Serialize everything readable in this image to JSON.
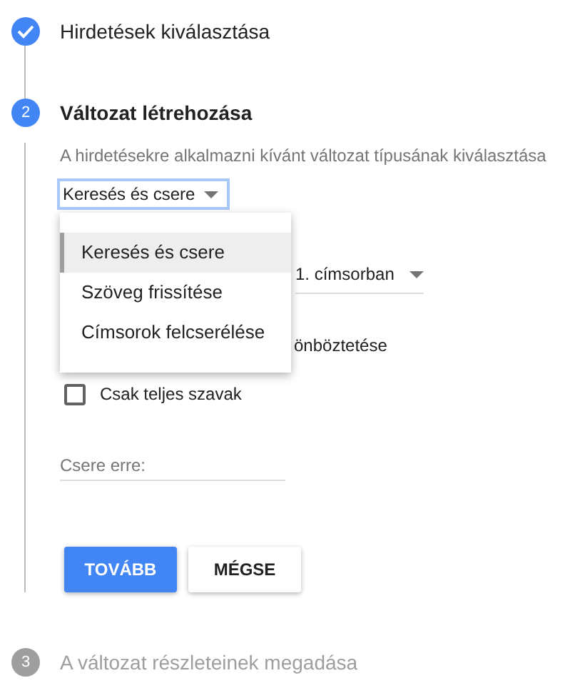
{
  "steps": [
    {
      "kind": "done",
      "title": "Hirdetések kiválasztása"
    },
    {
      "kind": "active",
      "number": "2",
      "title": "Változat létrehozása"
    },
    {
      "kind": "pending",
      "number": "3",
      "title": "A változat részleteinek megadása"
    }
  ],
  "form": {
    "description": "A hirdetésekre alkalmazni kívánt változat típusának kiválasztása",
    "type_select": {
      "value": "Keresés és csere",
      "expanded": true,
      "options": [
        {
          "label": "Keresés és csere",
          "selected": true
        },
        {
          "label": "Szöveg frissítése",
          "selected": false
        },
        {
          "label": "Címsorok felcserélése",
          "selected": false
        }
      ]
    },
    "location_select": {
      "value": "1. címsorban"
    },
    "case_option": {
      "label": "önböztetése"
    },
    "whole_words": {
      "label": "Csak teljes szavak",
      "checked": false
    },
    "replace_field": {
      "placeholder": "Csere erre:"
    },
    "buttons": [
      {
        "kind": "primary",
        "label": "TOVÁBB"
      },
      {
        "kind": "secondary",
        "label": "MÉGSE"
      }
    ]
  }
}
